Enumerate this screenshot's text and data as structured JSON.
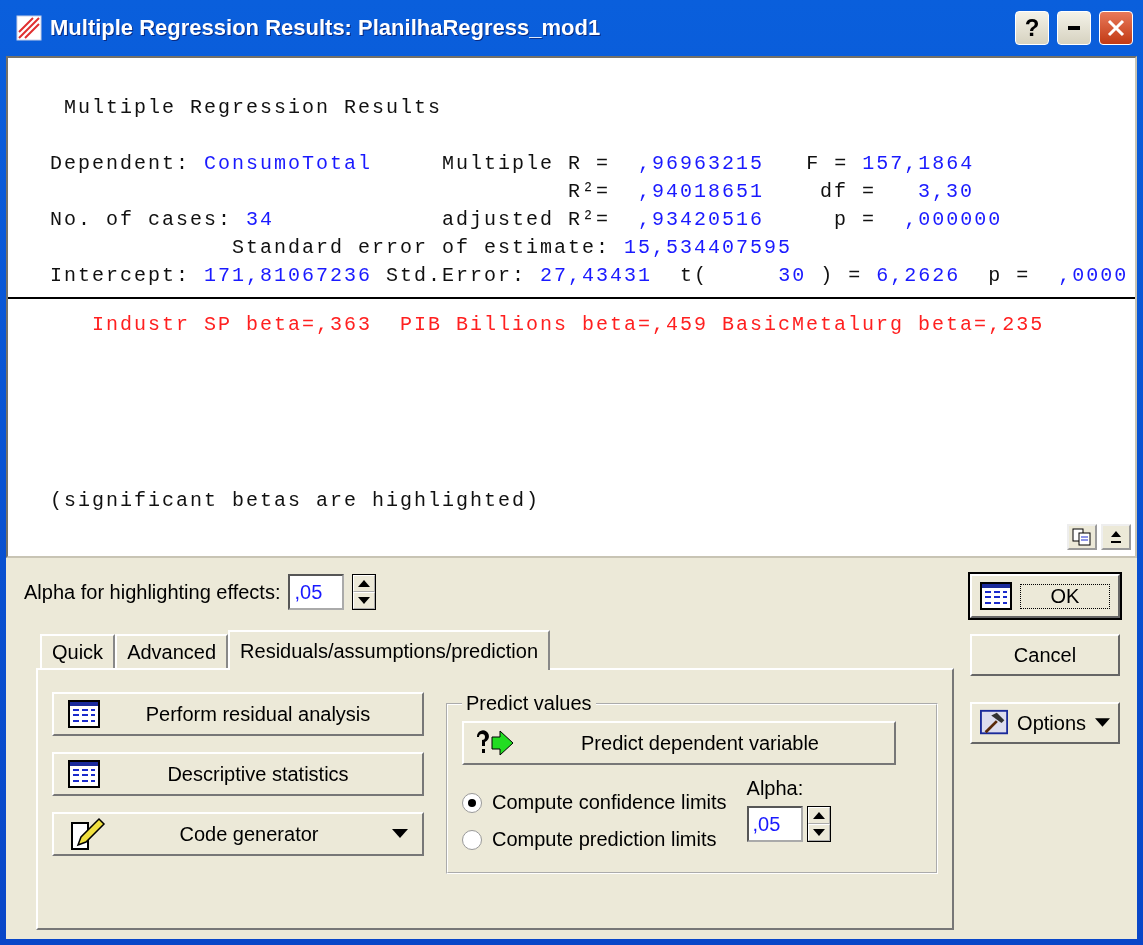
{
  "window": {
    "title": "Multiple Regression Results: PlanilhaRegress_mod1",
    "help": "?"
  },
  "results": {
    "heading": "Multiple Regression Results",
    "lines": [
      [
        {
          "kind": "label",
          "text": "Dependent:"
        },
        {
          "kind": "value",
          "text": "ConsumoTotal"
        },
        {
          "kind": "label",
          "text": "Multiple R ="
        },
        {
          "kind": "value",
          "text": ",96963215"
        },
        {
          "kind": "label",
          "text": "F ="
        },
        {
          "kind": "value",
          "text": "157,1864"
        }
      ],
      [
        {
          "kind": "label",
          "text": "R²="
        },
        {
          "kind": "value",
          "text": ",94018651"
        },
        {
          "kind": "label",
          "text": "df ="
        },
        {
          "kind": "value",
          "text": "3,30"
        }
      ],
      [
        {
          "kind": "label",
          "text": "No. of cases:"
        },
        {
          "kind": "value",
          "text": "34"
        },
        {
          "kind": "label",
          "text": "adjusted R²="
        },
        {
          "kind": "value",
          "text": ",93420516"
        },
        {
          "kind": "label",
          "text": "p ="
        },
        {
          "kind": "value",
          "text": ",000000"
        }
      ],
      [
        {
          "kind": "label",
          "text": "Standard error of estimate:"
        },
        {
          "kind": "value",
          "text": "15,534407595"
        }
      ],
      [
        {
          "kind": "label",
          "text": "Intercept:"
        },
        {
          "kind": "value",
          "text": "171,81067236"
        },
        {
          "kind": "label",
          "text": "Std.Error:"
        },
        {
          "kind": "value",
          "text": "27,43431"
        },
        {
          "kind": "label",
          "text": "t("
        },
        {
          "kind": "value",
          "text": "30"
        },
        {
          "kind": "label",
          "text": ") ="
        },
        {
          "kind": "value",
          "text": "6,2626"
        },
        {
          "kind": "label",
          "text": "p ="
        },
        {
          "kind": "value",
          "text": ",0000"
        }
      ]
    ],
    "betas": {
      "text": "Industr SP beta=,363  PIB Billions beta=,459 BasicMetalurg beta=,235",
      "highlighted": true
    },
    "note": "(significant betas are highlighted)"
  },
  "alpha_field": {
    "label": "Alpha for highlighting effects:",
    "value": ",05"
  },
  "tabs": [
    {
      "label": "Quick",
      "selected": false
    },
    {
      "label": "Advanced",
      "selected": false
    },
    {
      "label": "Residuals/assumptions/prediction",
      "selected": true
    }
  ],
  "actions": [
    {
      "label": "Perform residual analysis",
      "kind": "table"
    },
    {
      "label": "Descriptive statistics",
      "kind": "table"
    },
    {
      "label": "Code generator",
      "kind": "menu"
    }
  ],
  "predict": {
    "title": "Predict values",
    "button": "Predict dependent variable",
    "options": [
      {
        "label": "Compute confidence limits",
        "selected": true
      },
      {
        "label": "Compute prediction limits",
        "selected": false
      }
    ],
    "alpha_label": "Alpha:",
    "alpha_value": ",05"
  },
  "side_buttons": [
    {
      "label": "OK",
      "kind": "default"
    },
    {
      "label": "Cancel",
      "kind": "plain"
    },
    {
      "label": "Options",
      "kind": "menu"
    }
  ]
}
